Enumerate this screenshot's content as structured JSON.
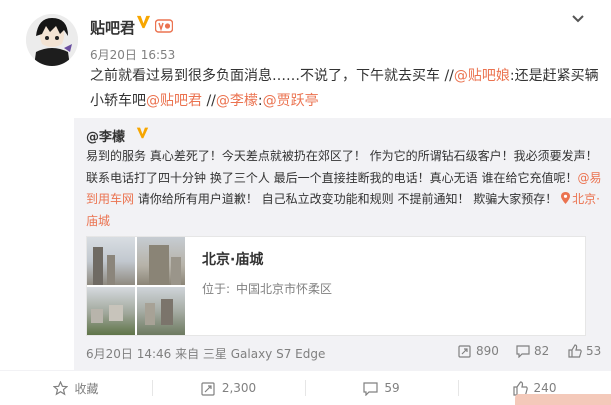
{
  "post": {
    "author": "贴吧君",
    "time": "6月20日 16:53",
    "text_parts": [
      "之前就看过易到很多负面消息……不说了，下午就去买车 //",
      "@贴吧娘",
      ":还是赶紧买辆小轿车吧",
      "@贴吧君",
      " //",
      "@李檬",
      ":",
      "@贾跃亭"
    ]
  },
  "repost": {
    "author": "@李檬",
    "text_parts": [
      "易到的服务 真心差死了！今天差点就被扔在郊区了！ 作为它的所谓钻石级客户！我必须要发声！ 联系电话打了四十分钟 换了三个人 最后一个直接挂断我的电话！真心无语 谁在给它充值呢！",
      "@易到用车网",
      " 请你给所有用户道歉！ 自己私立改变功能和规则 不提前通知！ 欺骗大家预存！ "
    ],
    "location": "北京·庙城",
    "map": {
      "title": "北京·庙城",
      "sub_label": "位于:",
      "sub_value": "中国北京市怀柔区"
    },
    "footer": {
      "time_source": "6月20日 14:46 来自 三星 Galaxy S7 Edge",
      "reposts": "890",
      "comments": "82",
      "likes": "53"
    }
  },
  "actions": {
    "collect": "收藏",
    "repost": "2,300",
    "comment": "59",
    "like": "240"
  },
  "icons": [
    "verified-icon",
    "member-icon",
    "chevron-down-icon",
    "location-icon",
    "repost-icon",
    "comment-icon",
    "like-icon",
    "star-icon"
  ],
  "colors": {
    "link": "#eb7350",
    "verified": "#f7a600",
    "muted": "#808080"
  }
}
